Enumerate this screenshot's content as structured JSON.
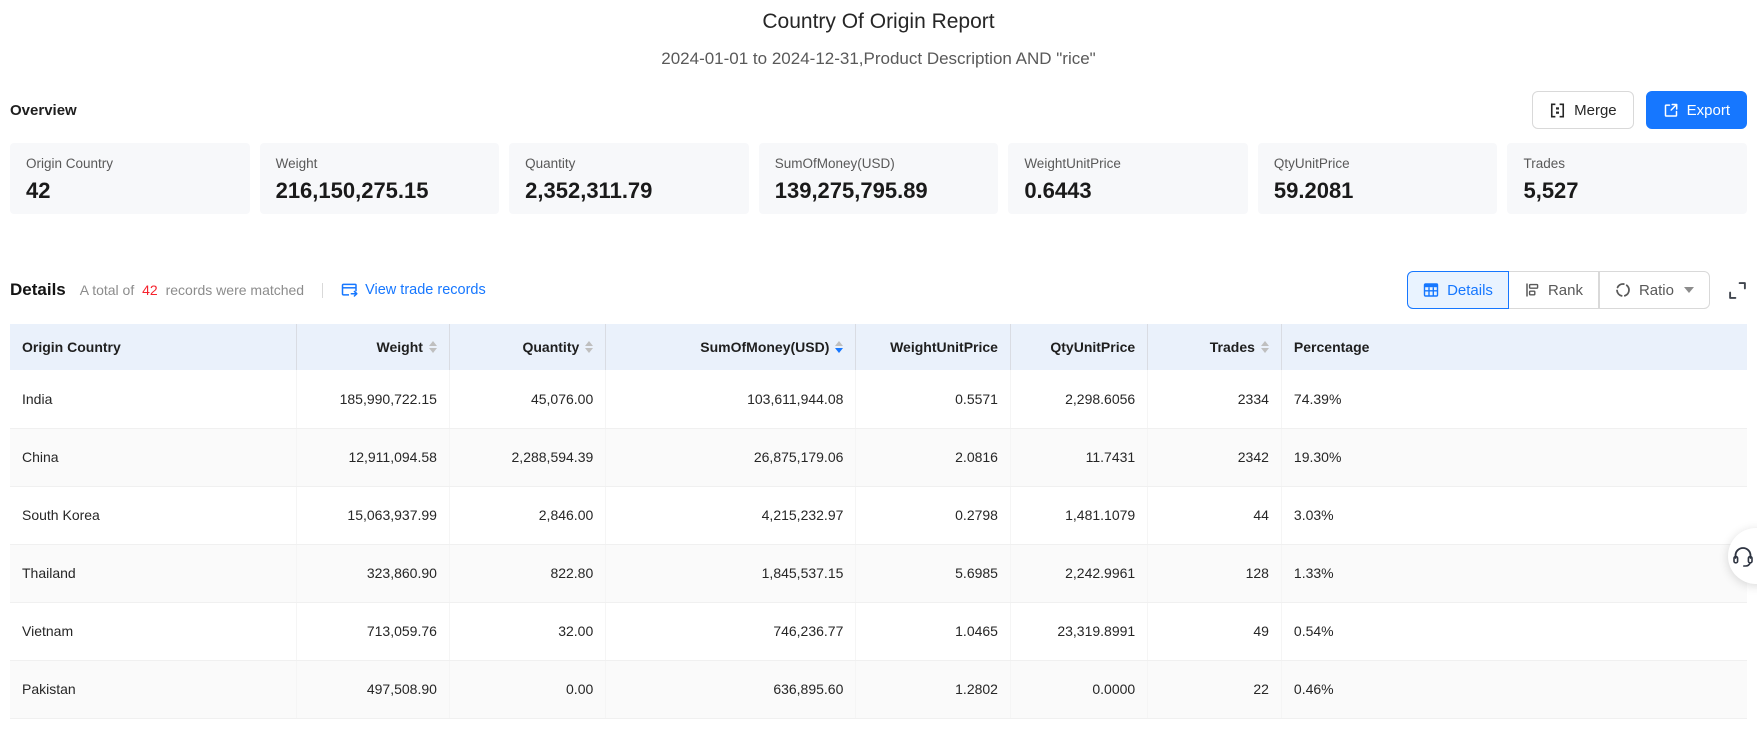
{
  "report": {
    "title": "Country Of Origin Report",
    "subtitle": "2024-01-01 to 2024-12-31,Product Description AND \"rice\""
  },
  "overview": {
    "heading": "Overview",
    "merge_label": "Merge",
    "export_label": "Export",
    "cards": [
      {
        "label": "Origin Country",
        "value": "42"
      },
      {
        "label": "Weight",
        "value": "216,150,275.15"
      },
      {
        "label": "Quantity",
        "value": "2,352,311.79"
      },
      {
        "label": "SumOfMoney(USD)",
        "value": "139,275,795.89"
      },
      {
        "label": "WeightUnitPrice",
        "value": "0.6443"
      },
      {
        "label": "QtyUnitPrice",
        "value": "59.2081"
      },
      {
        "label": "Trades",
        "value": "5,527"
      }
    ]
  },
  "details": {
    "heading": "Details",
    "total_prefix": "A total of",
    "total_count": "42",
    "total_suffix": "records were matched",
    "view_link": "View trade records",
    "tabs": [
      {
        "label": "Details",
        "active": true
      },
      {
        "label": "Rank",
        "active": false
      },
      {
        "label": "Ratio",
        "active": false,
        "has_dropdown": true
      }
    ]
  },
  "table": {
    "columns": [
      {
        "label": "Origin Country",
        "align": "left",
        "sortable": false
      },
      {
        "label": "Weight",
        "align": "right",
        "sortable": true
      },
      {
        "label": "Quantity",
        "align": "right",
        "sortable": true
      },
      {
        "label": "SumOfMoney(USD)",
        "align": "right",
        "sortable": true,
        "sorted": "desc"
      },
      {
        "label": "WeightUnitPrice",
        "align": "right",
        "sortable": false
      },
      {
        "label": "QtyUnitPrice",
        "align": "right",
        "sortable": false
      },
      {
        "label": "Trades",
        "align": "right",
        "sortable": true
      },
      {
        "label": "Percentage",
        "align": "left",
        "sortable": false
      }
    ],
    "rows": [
      [
        "India",
        "185,990,722.15",
        "45,076.00",
        "103,611,944.08",
        "0.5571",
        "2,298.6056",
        "2334",
        "74.39%"
      ],
      [
        "China",
        "12,911,094.58",
        "2,288,594.39",
        "26,875,179.06",
        "2.0816",
        "11.7431",
        "2342",
        "19.30%"
      ],
      [
        "South Korea",
        "15,063,937.99",
        "2,846.00",
        "4,215,232.97",
        "0.2798",
        "1,481.1079",
        "44",
        "3.03%"
      ],
      [
        "Thailand",
        "323,860.90",
        "822.80",
        "1,845,537.15",
        "5.6985",
        "2,242.9961",
        "128",
        "1.33%"
      ],
      [
        "Vietnam",
        "713,059.76",
        "32.00",
        "746,236.77",
        "1.0465",
        "23,319.8991",
        "49",
        "0.54%"
      ],
      [
        "Pakistan",
        "497,508.90",
        "0.00",
        "636,895.60",
        "1.2802",
        "0.0000",
        "22",
        "0.46%"
      ]
    ]
  },
  "colors": {
    "accent_blue": "#1677ff",
    "count_red": "#f5222d",
    "table_header_bg": "#eaf1fb",
    "row_alt_bg": "#fafafa",
    "card_bg": "#f7f8fa"
  }
}
